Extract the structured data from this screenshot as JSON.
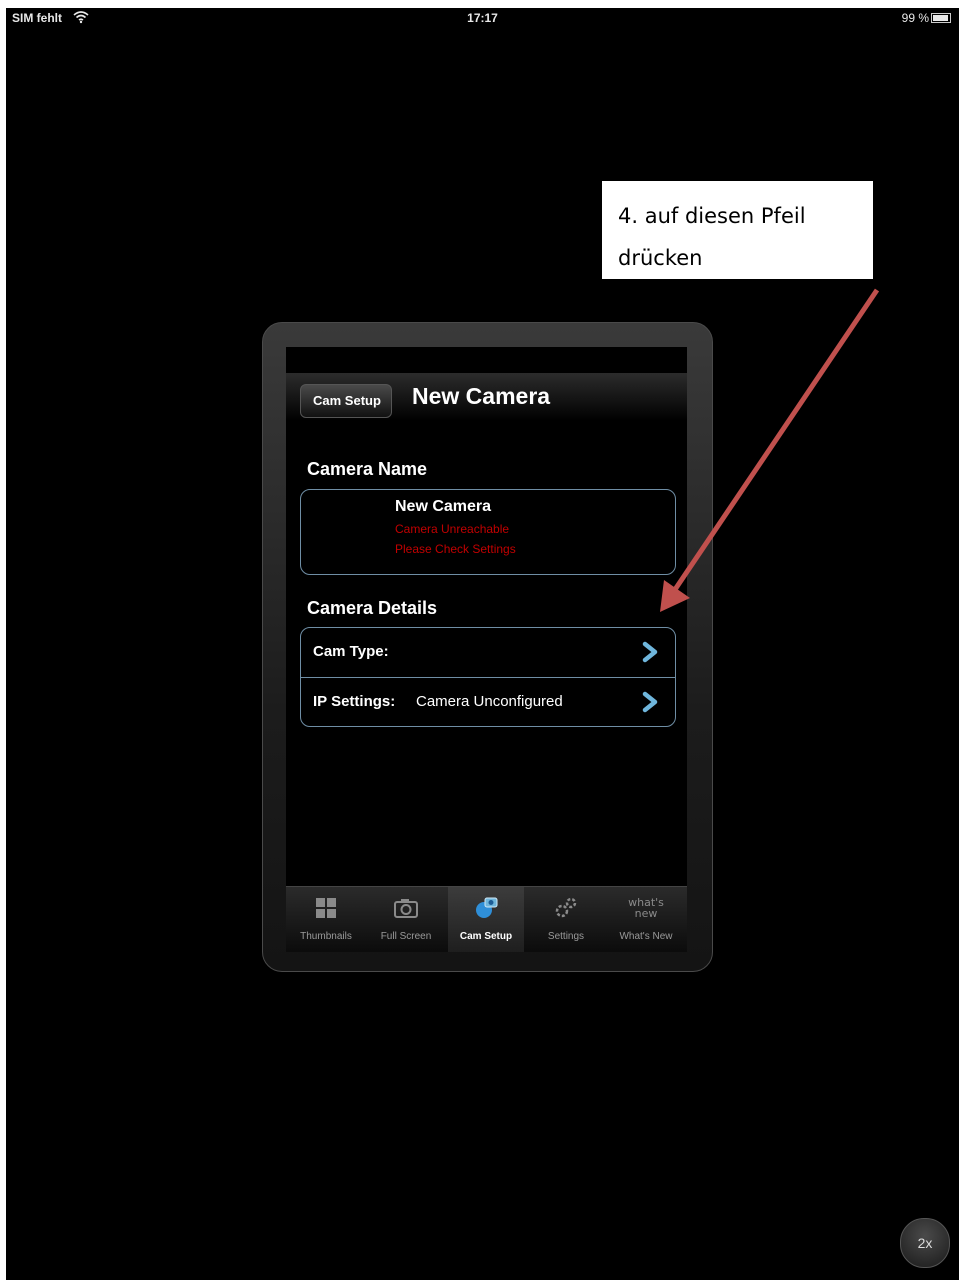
{
  "status_bar": {
    "carrier": "SIM fehlt",
    "time": "17:17",
    "battery": "99 %"
  },
  "annotation": {
    "line1": "4. auf diesen Pfeil",
    "line2": "drücken"
  },
  "nav": {
    "back_label": "Cam Setup",
    "title": "New Camera"
  },
  "camera_name_section": {
    "header": "Camera Name",
    "name": "New Camera",
    "status_line1": "Camera Unreachable",
    "status_line2": "Please Check Settings"
  },
  "camera_details_section": {
    "header": "Camera Details",
    "rows": [
      {
        "label": "Cam Type:",
        "value": ""
      },
      {
        "label": "IP Settings:",
        "value": "Camera Unconfigured"
      }
    ]
  },
  "tab_bar": {
    "tabs": [
      {
        "label": "Thumbnails",
        "icon": "grid-icon"
      },
      {
        "label": "Full Screen",
        "icon": "camera-icon"
      },
      {
        "label": "Cam Setup",
        "icon": "cam-setup-icon"
      },
      {
        "label": "Settings",
        "icon": "gears-icon"
      },
      {
        "label": "What's New",
        "icon": "whats-new-icon"
      }
    ],
    "active_index": 2,
    "whats_new_icon_text": "what's new"
  },
  "zoom_button": {
    "label": "2x"
  },
  "colors": {
    "accent_blue": "#6f8ea5",
    "error_red": "#c10000",
    "annotation_arrow": "#c0504d"
  }
}
